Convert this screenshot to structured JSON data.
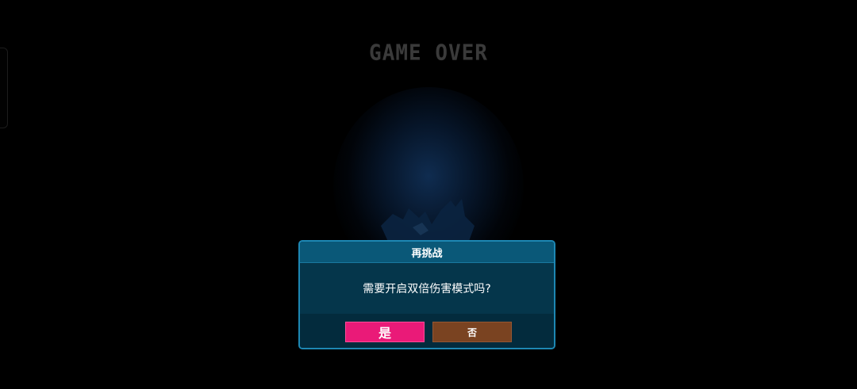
{
  "game": {
    "title": "GAME OVER"
  },
  "dialog": {
    "title": "再挑战",
    "message": "需要开启双倍伤害模式吗?",
    "confirm_label": "是",
    "cancel_label": "否"
  },
  "colors": {
    "background": "#000000",
    "title_text": "#3a3a3a",
    "dialog_border": "#1d87b3",
    "dialog_header": "#0a5878",
    "dialog_body": "#05364b",
    "confirm_button": "#ea1a78",
    "cancel_button": "#7a4321"
  }
}
